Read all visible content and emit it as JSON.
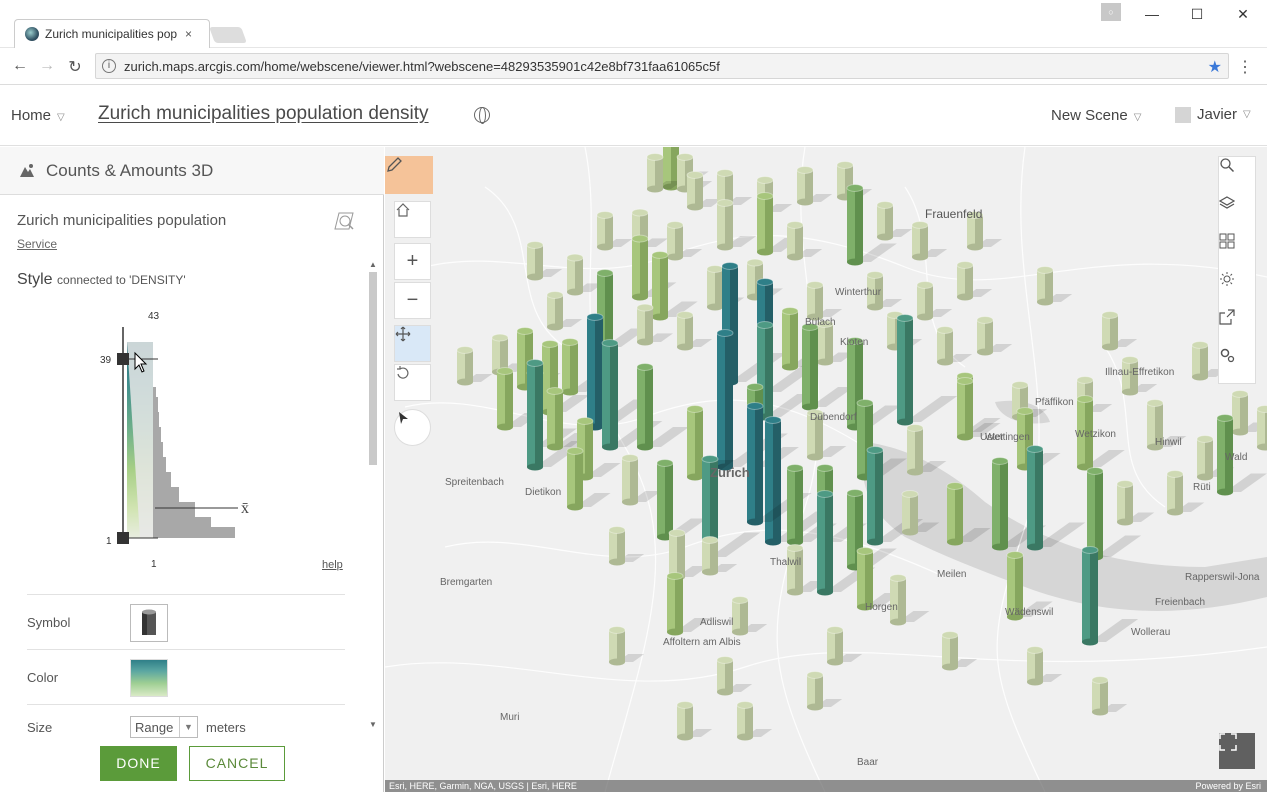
{
  "browser": {
    "tab_title": "Zurich municipalities pop",
    "tab_close": "×",
    "url": "zurich.maps.arcgis.com/home/webscene/viewer.html?webscene=48293535901c42e8bf731faa61065c5f",
    "window_controls": {
      "minimize": "—",
      "maximize": "☐",
      "close": "✕"
    }
  },
  "header": {
    "home_label": "Home",
    "scene_title": "Zurich municipalities population density",
    "new_scene_label": "New Scene",
    "user_label": "Javier"
  },
  "panel": {
    "title": "Counts & Amounts 3D",
    "layer_name": "Zurich municipalities population",
    "service_link": "Service",
    "style_label": "Style",
    "style_connected": "connected to 'DENSITY'",
    "histogram": {
      "max_label": "43",
      "handle_top_label": "39",
      "handle_bottom_label": "1",
      "axis_min_label": "1",
      "mean_symbol": "x̄",
      "help_link": "help"
    },
    "symbol_label": "Symbol",
    "color_label": "Color",
    "size_label": "Size",
    "size_mode": "Range",
    "size_unit": "meters",
    "done_label": "DONE",
    "cancel_label": "CANCEL"
  },
  "map": {
    "places": [
      {
        "name": "Frauenfeld",
        "big": true
      },
      {
        "name": "Winterthur",
        "big": false
      },
      {
        "name": "Zurich",
        "big": true
      },
      {
        "name": "Meilen",
        "big": false
      },
      {
        "name": "Bremgarten",
        "big": false
      },
      {
        "name": "Affoltern am Albis",
        "big": false
      },
      {
        "name": "Muri",
        "big": false
      },
      {
        "name": "Baar",
        "big": false
      },
      {
        "name": "Wollerau",
        "big": false
      },
      {
        "name": "Freienbach",
        "big": false
      },
      {
        "name": "Rapperswil-Jona",
        "big": false
      },
      {
        "name": "Horgen",
        "big": false
      },
      {
        "name": "Spreitenbach",
        "big": false
      },
      {
        "name": "Wettingen",
        "big": false
      },
      {
        "name": "Uster",
        "big": false
      },
      {
        "name": "Wetzikon",
        "big": false
      },
      {
        "name": "Hinwil",
        "big": false
      },
      {
        "name": "Rüti",
        "big": false
      },
      {
        "name": "Wald",
        "big": false
      },
      {
        "name": "Dietikon",
        "big": false
      },
      {
        "name": "Thalwil",
        "big": false
      },
      {
        "name": "Adliswil",
        "big": false
      },
      {
        "name": "Wädenswil",
        "big": false
      },
      {
        "name": "Kloten",
        "big": false
      },
      {
        "name": "Bülach",
        "big": false
      },
      {
        "name": "Dübendorf",
        "big": false
      },
      {
        "name": "Pfäffikon",
        "big": false
      },
      {
        "name": "Illnau-Effretikon",
        "big": false
      }
    ],
    "attribution": "Esri, HERE, Garmin, NGA, USGS | Esri, HERE",
    "powered_by": "Powered by Esri"
  },
  "colors": {
    "accent_green": "#5b9b3a",
    "pencil_orange": "#f5c399",
    "dark_teal": "#2f7f88",
    "light_green": "#c9dba8"
  }
}
